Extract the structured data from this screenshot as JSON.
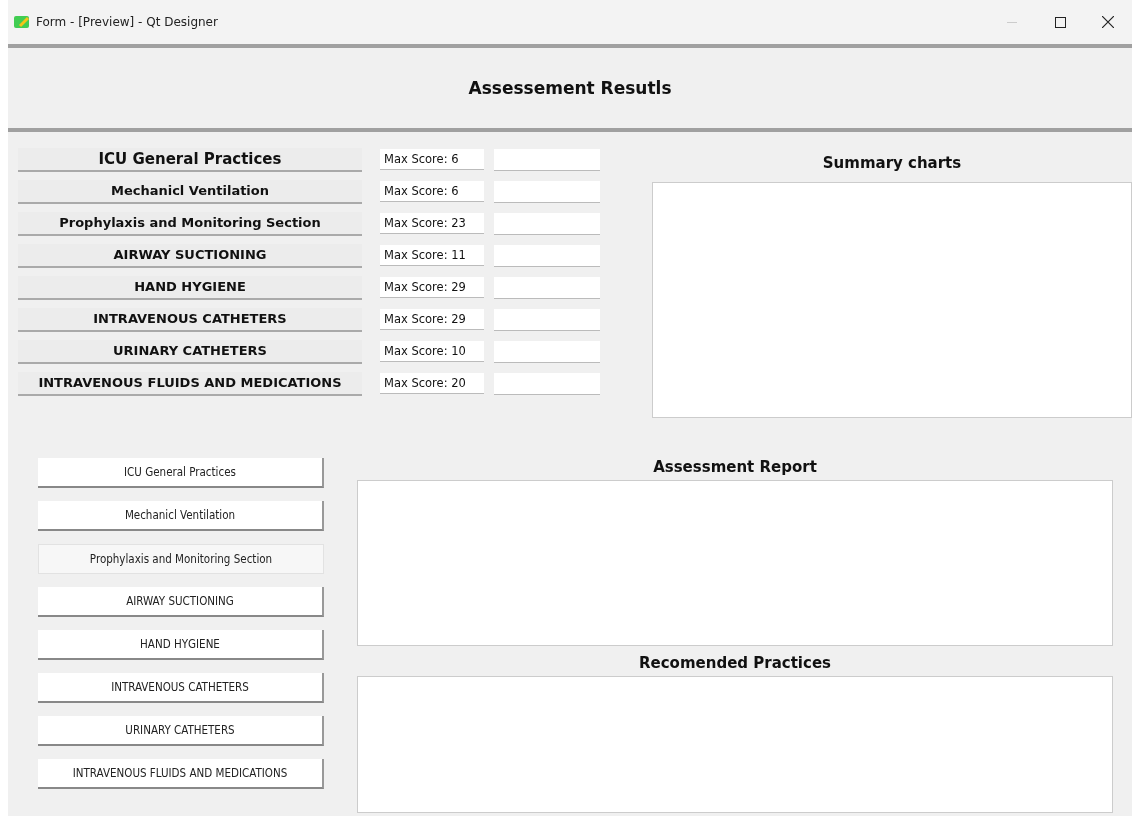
{
  "window": {
    "title": "Form - [Preview] - Qt Designer"
  },
  "header": {
    "title": "Assessement Resutls"
  },
  "sections": [
    {
      "label": "ICU General Practices",
      "max_score": "Max Score: 6"
    },
    {
      "label": "Mechanicl Ventilation",
      "max_score": "Max Score: 6"
    },
    {
      "label": "Prophylaxis and Monitoring Section",
      "max_score": "Max Score: 23"
    },
    {
      "label": "AIRWAY SUCTIONING",
      "max_score": "Max Score: 11"
    },
    {
      "label": "HAND HYGIENE",
      "max_score": "Max Score: 29"
    },
    {
      "label": "INTRAVENOUS CATHETERS",
      "max_score": "Max Score: 29"
    },
    {
      "label": "URINARY CATHETERS",
      "max_score": "Max Score: 10"
    },
    {
      "label": "INTRAVENOUS FLUIDS AND MEDICATIONS",
      "max_score": "Max Score: 20"
    }
  ],
  "summary": {
    "title": "Summary charts"
  },
  "buttons": [
    {
      "label": "ICU General Practices",
      "hovered": false
    },
    {
      "label": "Mechanicl Ventilation",
      "hovered": false
    },
    {
      "label": "Prophylaxis and Monitoring Section",
      "hovered": true
    },
    {
      "label": "AIRWAY SUCTIONING",
      "hovered": false
    },
    {
      "label": "HAND HYGIENE",
      "hovered": false
    },
    {
      "label": "INTRAVENOUS CATHETERS",
      "hovered": false
    },
    {
      "label": "URINARY CATHETERS",
      "hovered": false
    },
    {
      "label": "INTRAVENOUS FLUIDS AND MEDICATIONS",
      "hovered": false
    }
  ],
  "report": {
    "title": "Assessment Report"
  },
  "recommended": {
    "title": "Recomended Practices"
  }
}
